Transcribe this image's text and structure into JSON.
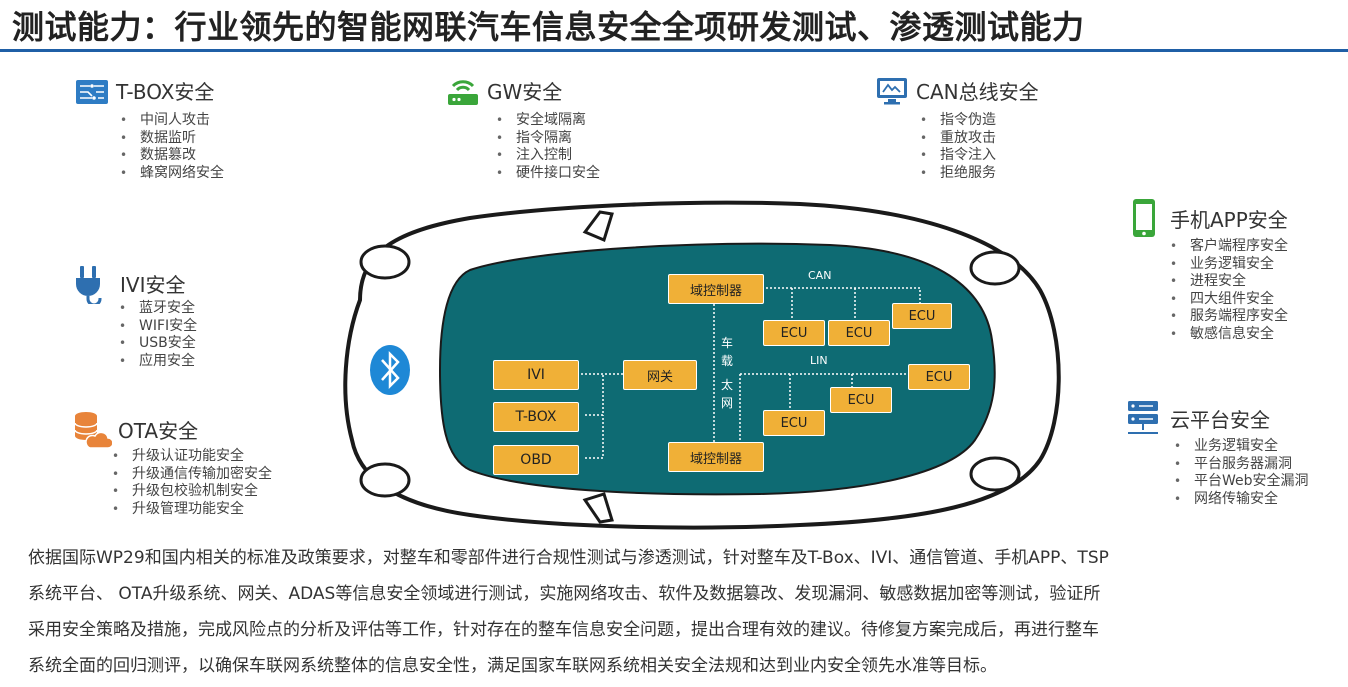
{
  "title": "测试能力：行业领先的智能网联汽车信息安全全项研发测试、渗透测试能力",
  "colors": {
    "accent": "#1f5fa6",
    "car_body": "#0e6b73",
    "box": "#f0b037",
    "icon_green": "#3aa63a"
  },
  "modules": {
    "tbox": {
      "name": "T-BOX安全",
      "icon": "circuit-board-icon",
      "items": [
        "中间人攻击",
        "数据监听",
        "数据篡改",
        "蜂窝网络安全"
      ]
    },
    "gw": {
      "name": "GW安全",
      "icon": "router-icon",
      "items": [
        "安全域隔离",
        "指令隔离",
        "注入控制",
        "硬件接口安全"
      ]
    },
    "can": {
      "name": "CAN总线安全",
      "icon": "monitor-icon",
      "items": [
        "指令伪造",
        "重放攻击",
        "指令注入",
        "拒绝服务"
      ]
    },
    "app": {
      "name": "手机APP安全",
      "icon": "smartphone-icon",
      "items": [
        "客户端程序安全",
        "业务逻辑安全",
        "进程安全",
        "四大组件安全",
        "服务端程序安全",
        "敏感信息安全"
      ]
    },
    "ivi": {
      "name": "IVI安全",
      "icon": "plug-icon",
      "items": [
        "蓝牙安全",
        "WIFI安全",
        "USB安全",
        "应用安全"
      ]
    },
    "ota": {
      "name": "OTA安全",
      "icon": "database-cloud-icon",
      "items": [
        "升级认证功能安全",
        "升级通信传输加密安全",
        "升级包校验机制安全",
        "升级管理功能安全"
      ]
    },
    "cloud": {
      "name": "云平台安全",
      "icon": "server-icon",
      "items": [
        "业务逻辑安全",
        "平台服务器漏洞",
        "平台Web安全漏洞",
        "网络传输安全"
      ]
    }
  },
  "diagram": {
    "boxes": {
      "ivi": "IVI",
      "tbox": "T-BOX",
      "obd": "OBD",
      "gateway": "网关",
      "domain_top": "域控制器",
      "domain_bottom": "域控制器",
      "ecu": "ECU"
    },
    "labels": {
      "can": "CAN",
      "lin": "LIN",
      "eth_top": [
        "车",
        "载"
      ],
      "eth_bottom": [
        "太",
        "网"
      ]
    }
  },
  "paragraph": [
    "依据国际WP29和国内相关的标准及政策要求，对整车和零部件进行合规性测试与渗透测试，针对整车及T-Box、IVI、通信管道、手机APP、TSP",
    "系统平台、 OTA升级系统、网关、ADAS等信息安全领域进行测试，实施网络攻击、软件及数据篡改、发现漏洞、敏感数据加密等测试，验证所",
    "采用安全策略及措施，完成风险点的分析及评估等工作，针对存在的整车信息安全问题，提出合理有效的建议。待修复方案完成后，再进行整车",
    "系统全面的回归测评，以确保车联网系统整体的信息安全性，满足国家车联网系统相关安全法规和达到业内安全领先水准等目标。"
  ]
}
